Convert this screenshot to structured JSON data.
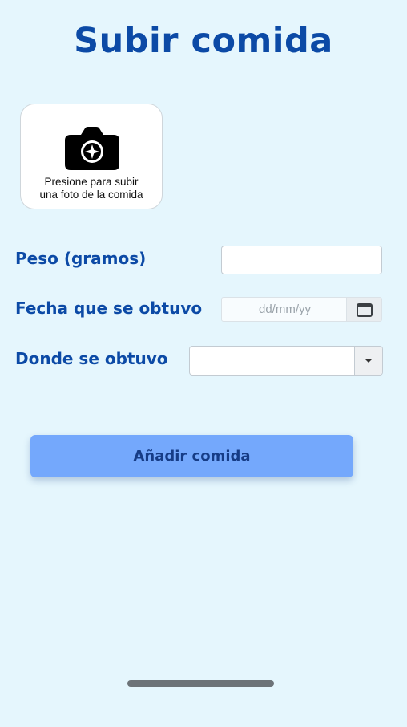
{
  "page": {
    "title": "Subir comida"
  },
  "photo_upload": {
    "icon": "camera-icon",
    "line1": "Presione para subir",
    "line2": "una foto de la comida"
  },
  "form": {
    "weight": {
      "label": "Peso (gramos)",
      "value": ""
    },
    "date": {
      "label": "Fecha que se obtuvo",
      "placeholder": "dd/mm/yy",
      "icon": "calendar-icon"
    },
    "location": {
      "label": "Donde se obtuvo",
      "selected": "",
      "icon": "dropdown-arrow-icon"
    }
  },
  "actions": {
    "add_label": "Añadir comida"
  },
  "colors": {
    "background": "#e5f6fd",
    "primary_text": "#0c4aa6",
    "button": "#74a8fc",
    "button_text": "#163c86"
  }
}
